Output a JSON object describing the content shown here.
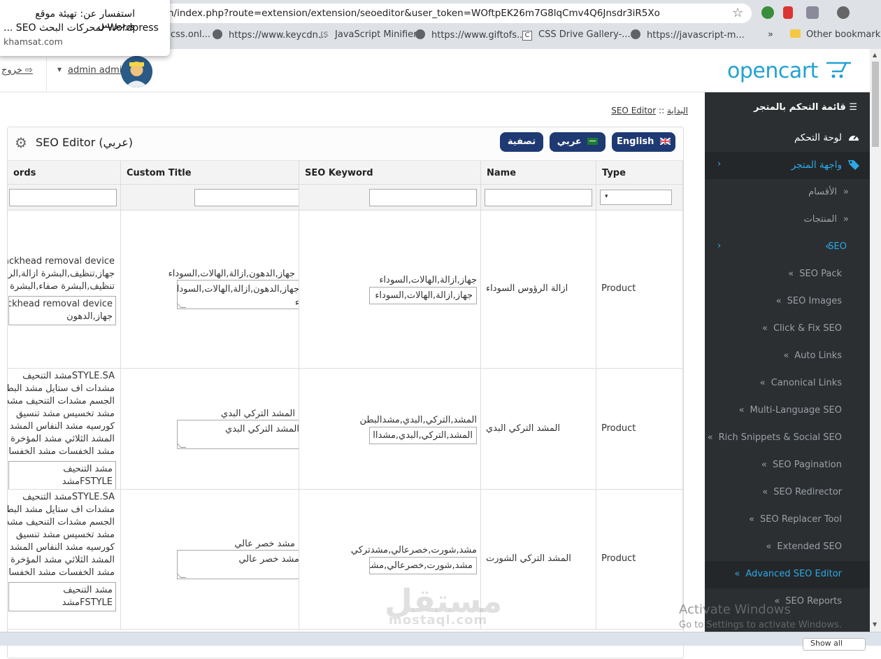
{
  "browser": {
    "url": "n/index.php?route=extension/extension/seoeditor&user_token=WOftpEK26m7G8lqCmv4Q6Jnsdr3iR5Xo",
    "bookmarks": [
      {
        "label": "css.onl...",
        "icon": "none"
      },
      {
        "label": "https://www.keycdn...",
        "icon": "globe-icon"
      },
      {
        "label": "JavaScript Minifier",
        "icon": "js-icon"
      },
      {
        "label": "https://www.giftofs...",
        "icon": "globe-icon"
      },
      {
        "label": "CSS Drive Gallery-...",
        "icon": "c-icon"
      },
      {
        "label": "https://javascript-m...",
        "icon": "globe-icon"
      },
      {
        "label": "»",
        "icon": "none"
      },
      {
        "label": "Other bookmarks",
        "icon": "folder-icon"
      }
    ]
  },
  "notification": {
    "title": "استفسار عن: تهيئة موقع ورديريس",
    "line2": "... SEO لمحركات البحث Wordpress",
    "source": "khamsat.com"
  },
  "header": {
    "logo": "opencart",
    "user": "admin admin",
    "logout": "خروج"
  },
  "sidebar": {
    "heading": "قائمة التحكم بالمتجر",
    "dashboard": "لوحة التحكم",
    "storefront": "واجهة المتجر",
    "categories": "الأقسام",
    "products": "المنتجات",
    "seo": "SEO",
    "seo_items": [
      "SEO Pack",
      "SEO Images",
      "Click & Fix SEO",
      "Auto Links",
      "Canonical Links",
      "Multi-Language SEO",
      "Rich Snippets & Social SEO",
      "SEO Pagination",
      "SEO Redirector",
      "SEO Replacer Tool",
      "Extended SEO",
      "Advanced SEO Editor",
      "SEO Reports"
    ]
  },
  "breadcrumb": {
    "home": "البداية",
    "sep": "::",
    "current": "SEO Editor"
  },
  "panel": {
    "title": "SEO Editor (عربي)",
    "btn_english": "English",
    "btn_arabic": "عربي",
    "btn_filter": "تصفية"
  },
  "table": {
    "headers": {
      "keywords": "ords",
      "custom_title": "Custom Title",
      "seo_keyword": "SEO Keyword",
      "name": "Name",
      "type": "Type"
    },
    "filter_select": "▾",
    "rows": [
      {
        "type": "Product",
        "name": "ازالة الرؤوس السوداء",
        "seo_label": "جهاز,ازالة,الهالات,السوداء",
        "seo_input": "جهاز,ازالة,الهالات,السوداء",
        "ct_label": "جهاز,الدهون,ازالة,الهالات,السوداء",
        "ct_lines": [
          "جهاز,الدهون,ازالة,الهالات,السودا",
          "ء"
        ],
        "kw_lines": [
          "Blackhead removal device ج",
          "جهاز,تنظيف,البشرة ازالة,الرؤو",
          "تنظيف,البشرة صفاء,البشرة"
        ],
        "kw_ta": [
          "Blackhead removal device",
          "جهاز,الدهون"
        ]
      },
      {
        "type": "Product",
        "name": "المشد التركي البدي",
        "seo_label": "المشد,التركي,البدي,مشدالبطن",
        "seo_input": "المشد,التركي,البدي,مشداا",
        "ct_label": "المشد التركي البدي",
        "ct_lines": [
          "المشد التركي البدي"
        ],
        "kw_lines": [
          "STYLE.SAمشد التنحيف",
          "مشدات اف ستايل مشد البط",
          "الجسم مشدات التنحيف مشد",
          "مشد تخسيس مشد تنسيق",
          "كورسيه مشد النفاس المشد",
          "المشد الثلاثي مشد المؤخرة",
          "مشد الخفسات مشد الخفسا"
        ],
        "kw_ta": [
          "مشد التنحيف",
          "FSTYLEمشد"
        ]
      },
      {
        "type": "Product",
        "name": "المشد التركي الشورت",
        "seo_label": "مشد,شورت,خصرعالي,مشدتركي",
        "seo_input": "مشد,شورت,خصرعالي,مشـ",
        "ct_label": "مشد خصر عالي",
        "ct_lines": [
          "مشد خصر عالي"
        ],
        "kw_lines": [
          "STYLE.SAمشد التنحيف",
          "مشدات اف ستايل مشد البط",
          "الجسم مشدات التنحيف مشد",
          "مشد تخسيس مشد تنسيق",
          "كورسيه مشد النفاس المشد",
          "المشد الثلاثي مشد المؤخرة",
          "مشد الخفسات مشد الخفسا"
        ],
        "kw_ta": [
          "مشد التنحيف",
          "FSTYLEمشد"
        ]
      }
    ]
  },
  "watermark": {
    "line1": "مستقل",
    "line2": "mostaql.com"
  },
  "activate": {
    "line1": "Activate Windows",
    "line2": "Go to Settings to activate Windows."
  },
  "bottom_button": "Show all"
}
